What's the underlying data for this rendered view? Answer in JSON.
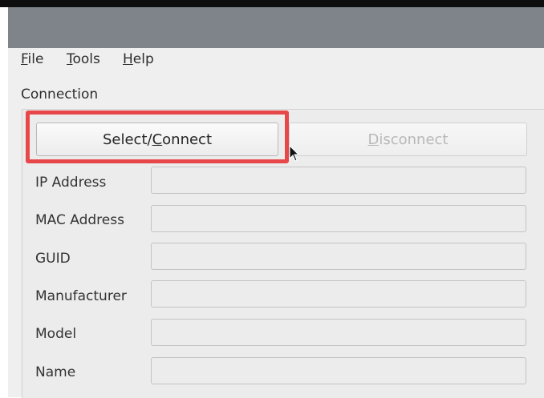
{
  "menu": {
    "file": {
      "mnemonic": "F",
      "rest": "ile"
    },
    "tools": {
      "mnemonic": "T",
      "rest": "ools"
    },
    "help": {
      "mnemonic": "H",
      "rest": "elp"
    }
  },
  "connection": {
    "title": "Connection",
    "select_button": {
      "before": "Select/",
      "mnemonic": "C",
      "after": "onnect"
    },
    "disconnect_button": {
      "mnemonic": "D",
      "after": "isconnect",
      "enabled": false
    }
  },
  "fields": [
    {
      "label": "IP Address",
      "value": ""
    },
    {
      "label": "MAC Address",
      "value": ""
    },
    {
      "label": "GUID",
      "value": ""
    },
    {
      "label": "Manufacturer",
      "value": ""
    },
    {
      "label": "Model",
      "value": ""
    },
    {
      "label": "Name",
      "value": ""
    }
  ],
  "colors": {
    "highlight": "#e8474a",
    "titlebar": "#7e848a",
    "window_bg": "#efefef"
  },
  "cursor": "arrow-pointer-icon"
}
